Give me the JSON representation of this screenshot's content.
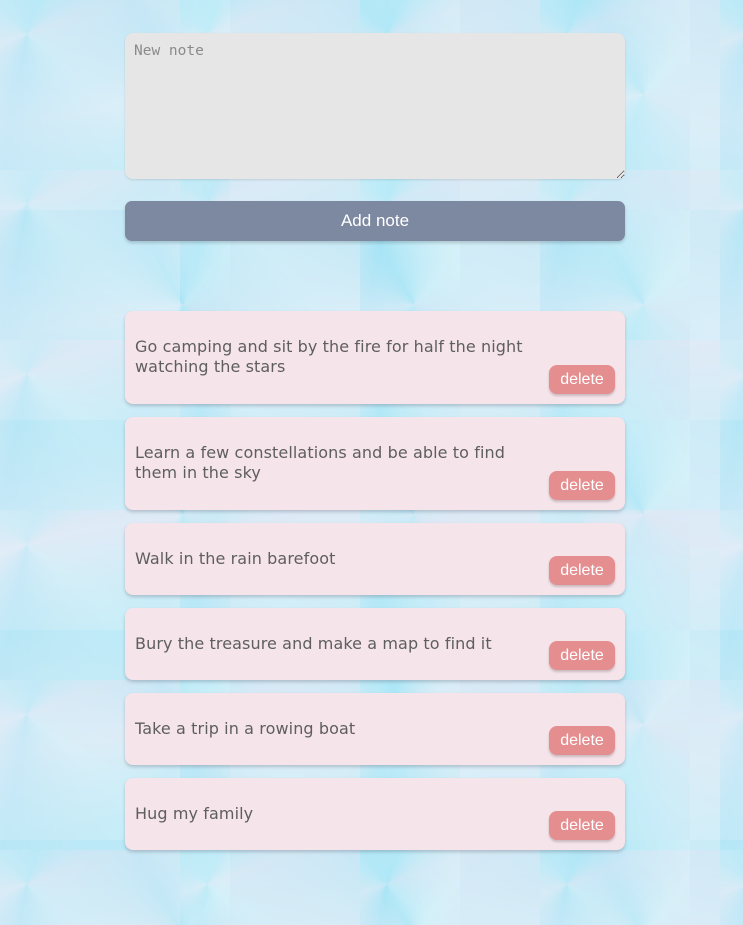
{
  "colors": {
    "add_button": "#7d89a1",
    "delete_button": "#e58e90",
    "note_background": "#f5e4ea",
    "textarea_background": "#e6e6e6"
  },
  "composer": {
    "placeholder": "New note",
    "value": "",
    "add_label": "Add note"
  },
  "notes": [
    {
      "text": "Go camping and sit by the fire for half the night watching the stars",
      "delete_label": "delete"
    },
    {
      "text": "Learn a few constellations and be able to find them in the sky",
      "delete_label": "delete"
    },
    {
      "text": "Walk in the rain barefoot",
      "delete_label": "delete"
    },
    {
      "text": "Bury the treasure and make a map to find it",
      "delete_label": "delete"
    },
    {
      "text": "Take a trip in a rowing boat",
      "delete_label": "delete"
    },
    {
      "text": "Hug my family",
      "delete_label": "delete"
    }
  ]
}
